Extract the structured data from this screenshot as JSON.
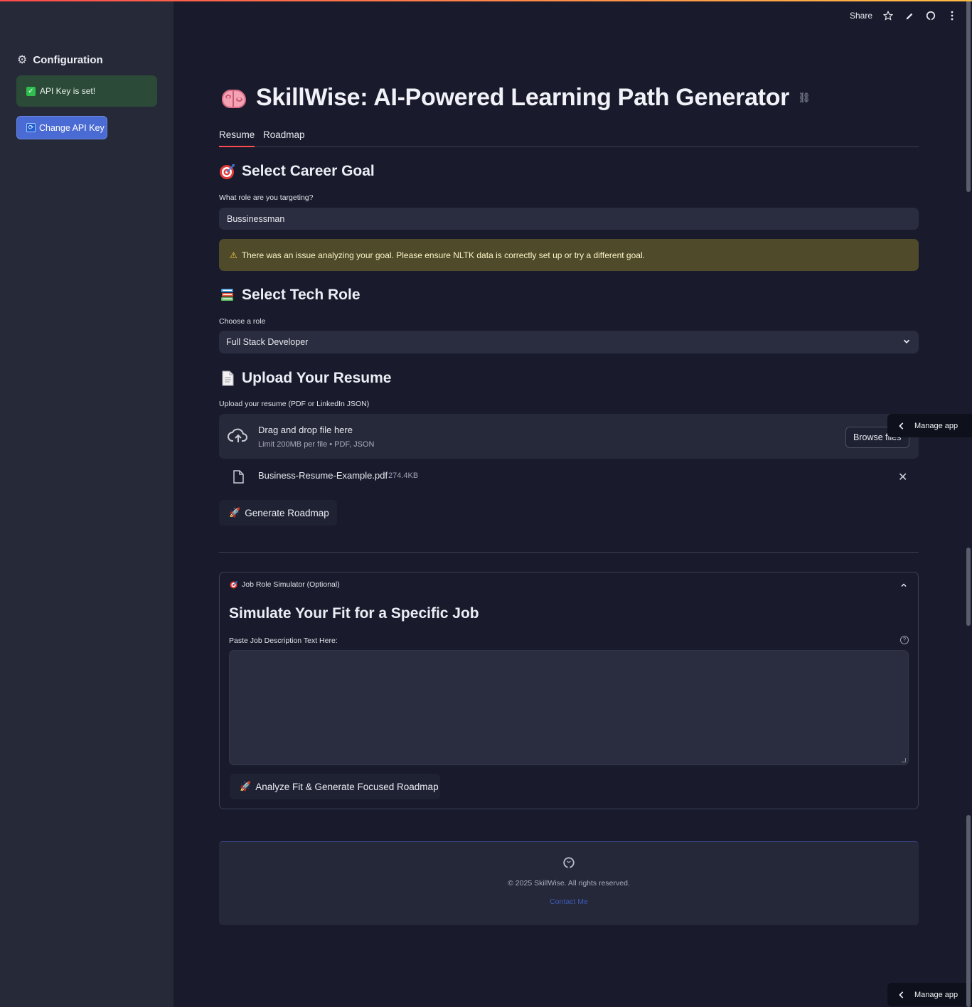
{
  "sidebar": {
    "title": "Configuration",
    "api_status": "API Key is set!",
    "change_button": "Change API Key"
  },
  "toolbar": {
    "share_label": "Share",
    "icons": [
      "star-icon",
      "edit-icon",
      "github-icon",
      "more-icon"
    ]
  },
  "app": {
    "title": "SkillWise: AI-Powered Learning Path Generator",
    "tabs": [
      "Resume",
      "Roadmap"
    ],
    "active_tab": "Resume"
  },
  "career_goal": {
    "heading": "Select Career Goal",
    "label": "What role are you targeting?",
    "value": "Bussinessman",
    "warning": "There was an issue analyzing your goal. Please ensure NLTK data is correctly set up or try a different goal."
  },
  "tech_role": {
    "heading": "Select Tech Role",
    "label": "Choose a role",
    "selected": "Full Stack Developer"
  },
  "resume": {
    "heading": "Upload Your Resume",
    "label": "Upload your resume (PDF or LinkedIn JSON)",
    "drop_text": "Drag and drop file here",
    "limit_text": "Limit 200MB per file • PDF, JSON",
    "browse_label": "Browse files",
    "file_name": "Business-Resume-Example.pdf",
    "file_size": "274.4KB",
    "generate_button": "Generate Roadmap"
  },
  "simulator": {
    "expander_label": "Job Role Simulator (Optional)",
    "heading": "Simulate Your Fit for a Specific Job",
    "label": "Paste Job Description Text Here:",
    "textarea_value": "",
    "analyze_button": "Analyze Fit & Generate Focused Roadmap"
  },
  "footer": {
    "copyright": "© 2025 SkillWise. All rights reserved.",
    "contact": "Contact Me"
  },
  "manage_app": {
    "label": "Manage app"
  },
  "colors": {
    "accent": "#ff4b4b",
    "background": "#191b2d",
    "sidebar": "#262a38",
    "success_bg": "#2b4a38",
    "warning_bg": "#4f4a2a",
    "primary_button": "#4b6bd4"
  }
}
